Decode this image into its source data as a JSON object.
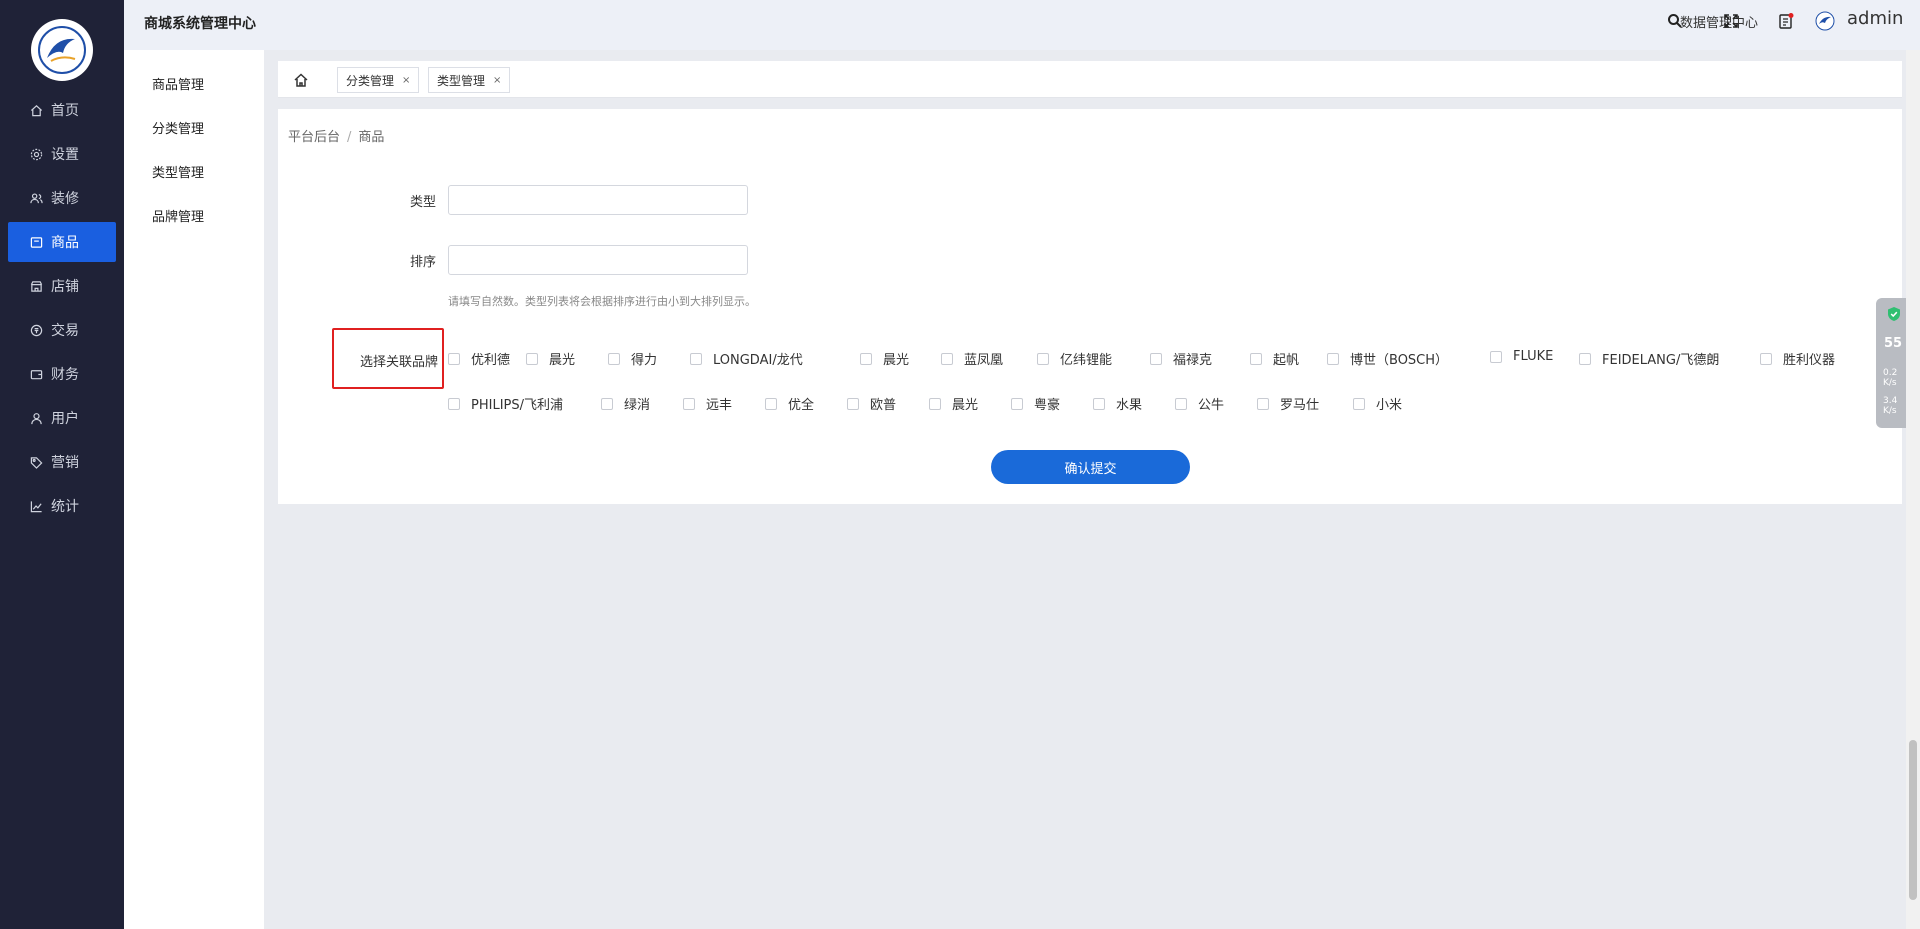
{
  "app": {
    "system_title": "商城系统管理中心",
    "data_center": "数据管理中心",
    "username": "admin"
  },
  "nav": {
    "items": [
      {
        "label": "首页",
        "icon": "home-icon"
      },
      {
        "label": "设置",
        "icon": "gear-icon"
      },
      {
        "label": "装修",
        "icon": "users-icon"
      },
      {
        "label": "商品",
        "icon": "box-icon",
        "active": true
      },
      {
        "label": "店铺",
        "icon": "store-icon"
      },
      {
        "label": "交易",
        "icon": "trade-icon"
      },
      {
        "label": "财务",
        "icon": "wallet-icon"
      },
      {
        "label": "用户",
        "icon": "user-icon"
      },
      {
        "label": "营销",
        "icon": "tag-icon"
      },
      {
        "label": "统计",
        "icon": "chart-icon"
      }
    ]
  },
  "submenu": {
    "items": [
      "商品管理",
      "分类管理",
      "类型管理",
      "品牌管理"
    ]
  },
  "tabs": [
    {
      "label": "分类管理",
      "close": "×"
    },
    {
      "label": "类型管理",
      "close": "×"
    }
  ],
  "breadcrumb": {
    "root": "平台后台",
    "separator": "/",
    "current": "商品"
  },
  "form": {
    "type_label": "类型",
    "type_value": "",
    "sort_label": "排序",
    "sort_value": "",
    "sort_hint": "请填写自然数。类型列表将会根据排序进行由小到大排列显示。",
    "brands_label": "选择关联品牌",
    "brands": [
      "优利德",
      "晨光",
      "得力",
      "LONGDAI/龙代",
      "晨光",
      "蓝凤凰",
      "亿纬锂能",
      "福禄克",
      "起帆",
      "博世（BOSCH）",
      "FLUKE",
      "FEIDELANG/飞德朗",
      "胜利仪器",
      "PHILIPS/飞利浦",
      "绿消",
      "远丰",
      "优全",
      "欧普",
      "晨光",
      "粤豪",
      "水果",
      "公牛",
      "罗马仕",
      "小米"
    ],
    "submit_label": "确认提交"
  },
  "widget": {
    "percent": "55",
    "upload": "0.2",
    "download": "3.4",
    "unit": "K/s"
  },
  "colors": {
    "nav_bg": "#1f2237",
    "accent": "#1a5fe0",
    "highlight": "#e02020"
  }
}
